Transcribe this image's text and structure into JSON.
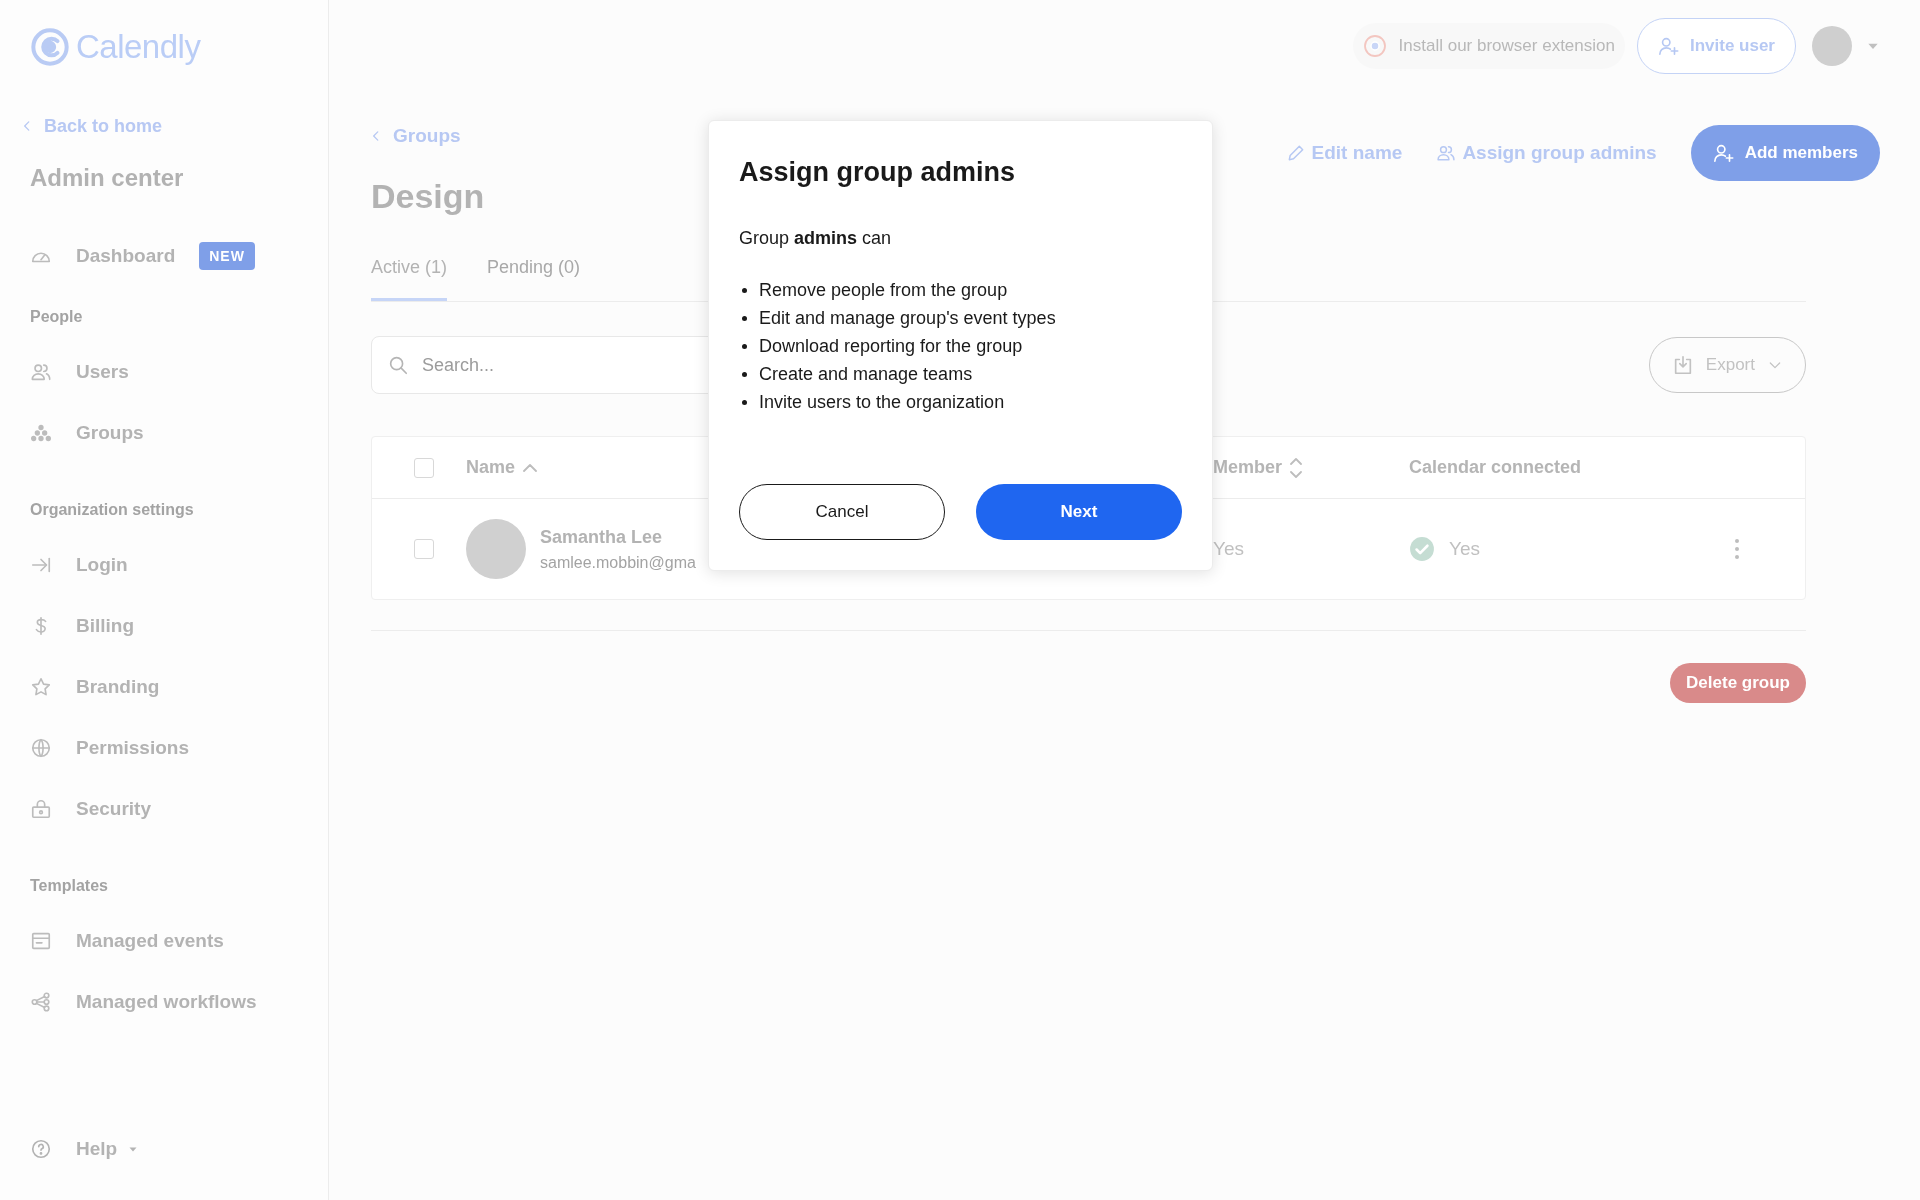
{
  "sidebar": {
    "logo": "Calendly",
    "back_link": "Back to home",
    "title": "Admin center",
    "sections": [
      {
        "items": [
          {
            "label": "Dashboard",
            "badge": "NEW"
          }
        ]
      },
      {
        "heading": "People",
        "items": [
          {
            "label": "Users"
          },
          {
            "label": "Groups"
          }
        ]
      },
      {
        "heading": "Organization settings",
        "items": [
          {
            "label": "Login"
          },
          {
            "label": "Billing"
          },
          {
            "label": "Branding"
          },
          {
            "label": "Permissions"
          },
          {
            "label": "Security"
          }
        ]
      },
      {
        "heading": "Templates",
        "items": [
          {
            "label": "Managed events"
          },
          {
            "label": "Managed workflows"
          }
        ]
      }
    ],
    "help": "Help"
  },
  "header": {
    "extension": "Install our browser extension",
    "invite": "Invite user"
  },
  "page": {
    "breadcrumb": "Groups",
    "title": "Design",
    "actions": [
      "Edit name",
      "Assign group admins"
    ],
    "primary": "Add members",
    "tabs": [
      {
        "label": "Active (1)",
        "selected": true
      },
      {
        "label": "Pending (0)",
        "selected": false
      }
    ],
    "search": {
      "placeholder": "Search..."
    },
    "export": "Export",
    "table": {
      "header_checked": false,
      "columns": [
        {
          "label": "Name",
          "sortable": true,
          "sorted": true
        },
        {
          "label": "Member",
          "sortable": true,
          "sorted": false
        },
        {
          "label": "Calendar connected",
          "sortable": false
        }
      ],
      "rows": [
        {
          "checked": false,
          "name": "Samantha Lee",
          "email": "samlee.mobbin@gma",
          "member": "Yes",
          "calendar": "Yes"
        }
      ]
    },
    "delete": "Delete group"
  },
  "modal": {
    "title": "Assign group admins",
    "intro": "Group **admins** can",
    "items": [
      "Remove people from the group",
      "Edit and manage group's event types",
      "Download reporting for the group",
      "Create and manage teams",
      "Invite users to the organization"
    ],
    "buttons": [
      {
        "label": "Cancel",
        "kind": "secondary"
      },
      {
        "label": "Next",
        "kind": "primary"
      }
    ]
  }
}
